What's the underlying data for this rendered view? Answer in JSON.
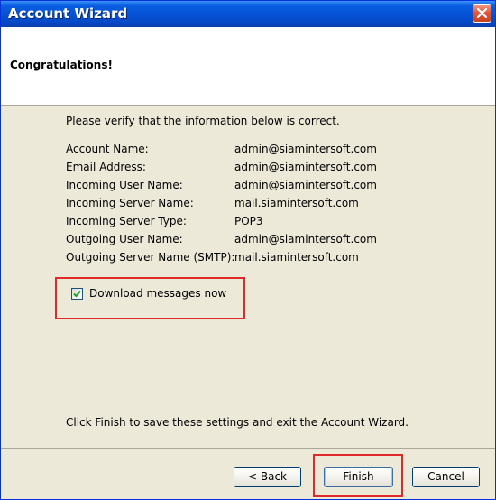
{
  "window": {
    "title": "Account Wizard"
  },
  "header": {
    "title": "Congratulations!"
  },
  "main": {
    "verify_text": "Please verify that the information below is correct.",
    "info": [
      {
        "label": "Account Name:",
        "value": "admin@siamintersoft.com"
      },
      {
        "label": "Email Address:",
        "value": "admin@siamintersoft.com"
      },
      {
        "label": "Incoming User Name:",
        "value": "admin@siamintersoft.com"
      },
      {
        "label": "Incoming Server Name:",
        "value": "mail.siamintersoft.com"
      },
      {
        "label": "Incoming Server Type:",
        "value": "POP3"
      },
      {
        "label": "Outgoing User Name:",
        "value": "admin@siamintersoft.com"
      },
      {
        "label": "Outgoing Server Name (SMTP):",
        "value": "mail.siamintersoft.com"
      }
    ],
    "download_checkbox": {
      "label": "Download messages now",
      "checked": true
    },
    "finish_message": "Click Finish to save these settings and exit the Account Wizard."
  },
  "footer": {
    "back_label": "< Back",
    "finish_label": "Finish",
    "cancel_label": "Cancel"
  },
  "colors": {
    "titlebar": "#0553d6",
    "highlight": "#e02a2a",
    "dialog_bg": "#ece9d8",
    "checkmark": "#21a121"
  },
  "icons": {
    "close": "close-icon",
    "check": "checkmark-icon"
  }
}
